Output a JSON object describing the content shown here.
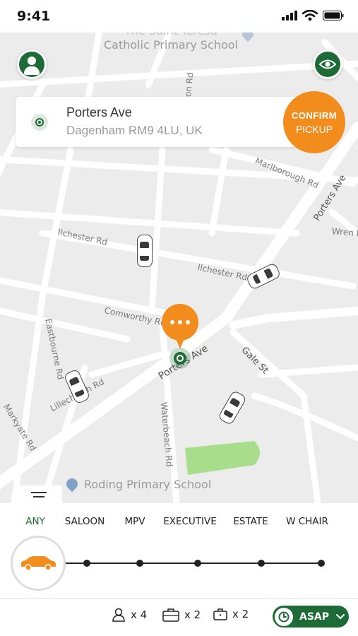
{
  "status_bar": {
    "time": "9:41"
  },
  "map": {
    "poi_top": {
      "line1": "The Saint Teresa",
      "line2": "Catholic Primary School"
    },
    "poi_bottom": "Roding Primary School",
    "streets": {
      "ilchester1": "Ilchester Rd",
      "ilchester2": "Ilchester Rd",
      "comworthy": "Comworthy Rd",
      "porters_main": "Porters Ave",
      "porters_upper": "Porters Ave",
      "gale": "Gale St",
      "waterbeach": "Waterbeach Rd",
      "marlborough": "Marlborough Rd",
      "wren": "Wren R",
      "eastbourne": "Eastbourne Rd",
      "lillechurch": "Lillechurch Rd",
      "markyate": "Markyate Rd",
      "top_road": "on Rd"
    }
  },
  "pickup": {
    "title": "Porters Ave",
    "subtitle": "Dagenham RM9 4LU, UK",
    "confirm_line1": "CONFIRM",
    "confirm_line2": "PICKUP"
  },
  "vehicle_tabs": [
    "ANY",
    "SALOON",
    "MPV",
    "EXECUTIVE",
    "ESTATE",
    "W CHAIR"
  ],
  "selected_tab": "ANY",
  "capacity": {
    "passengers": "x 4",
    "luggage": "x 2",
    "hand_luggage": "x 2"
  },
  "schedule": {
    "label": "ASAP"
  },
  "colors": {
    "accent_orange": "#f28c1c",
    "brand_green": "#1e6b37"
  }
}
